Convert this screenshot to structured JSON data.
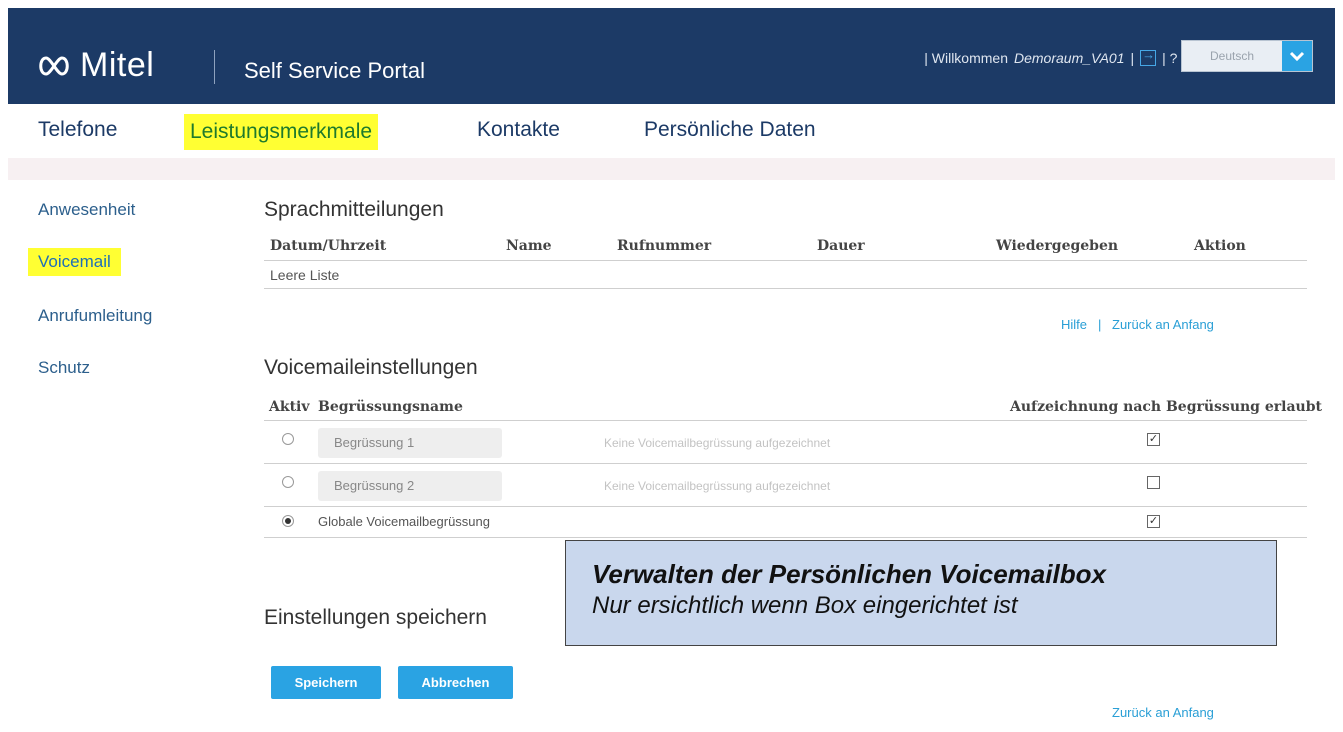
{
  "header": {
    "brand": "Mitel",
    "portal_title": "Self Service Portal",
    "welcome_prefix": "| Willkommen",
    "user": "Demoraum_VA01",
    "sep1": "|",
    "help": "| ? |",
    "language": "Deutsch"
  },
  "nav": {
    "items": [
      {
        "label": "Telefone"
      },
      {
        "label": "Leistungsmerkmale",
        "active": true
      },
      {
        "label": "Kontakte"
      },
      {
        "label": "Persönliche Daten"
      }
    ]
  },
  "sidebar": {
    "items": [
      {
        "label": "Anwesenheit"
      },
      {
        "label": "Voicemail",
        "active": true
      },
      {
        "label": "Anrufumleitung"
      },
      {
        "label": "Schutz"
      }
    ]
  },
  "messages": {
    "title": "Sprachmitteilungen",
    "columns": [
      "Datum/Uhrzeit",
      "Name",
      "Rufnummer",
      "Dauer",
      "Wiedergegeben",
      "Aktion"
    ],
    "empty_text": "Leere Liste",
    "help_link": "Hilfe",
    "link_sep": "|",
    "top_link": "Zurück an Anfang"
  },
  "settings": {
    "title": "Voicemaileinstellungen",
    "col_active": "Aktiv",
    "col_name": "Begrüssungsname",
    "col_record": "Aufzeichnung nach Begrüssung erlaubt",
    "rows": [
      {
        "name": "Begrüssung 1",
        "status": "Keine Voicemailbegrüssung aufgezeichnet",
        "selected": false,
        "record_allowed": true
      },
      {
        "name": "Begrüssung 2",
        "status": "Keine Voicemailbegrüssung aufgezeichnet",
        "selected": false,
        "record_allowed": false
      },
      {
        "name": "Globale Voicemailbegrüssung",
        "selected": true,
        "record_allowed": true
      }
    ]
  },
  "save": {
    "title": "Einstellungen speichern",
    "save_label": "Speichern",
    "cancel_label": "Abbrechen",
    "top_link": "Zurück an Anfang"
  },
  "callout": {
    "line1": "Verwalten der Persönlichen Voicemailbox",
    "line2": "Nur ersichtlich wenn Box eingerichtet ist"
  },
  "colors": {
    "header_bg": "#1c3a66",
    "accent": "#2aa3e3",
    "highlight": "#ffff33",
    "callout_bg": "#c9d7ed"
  }
}
